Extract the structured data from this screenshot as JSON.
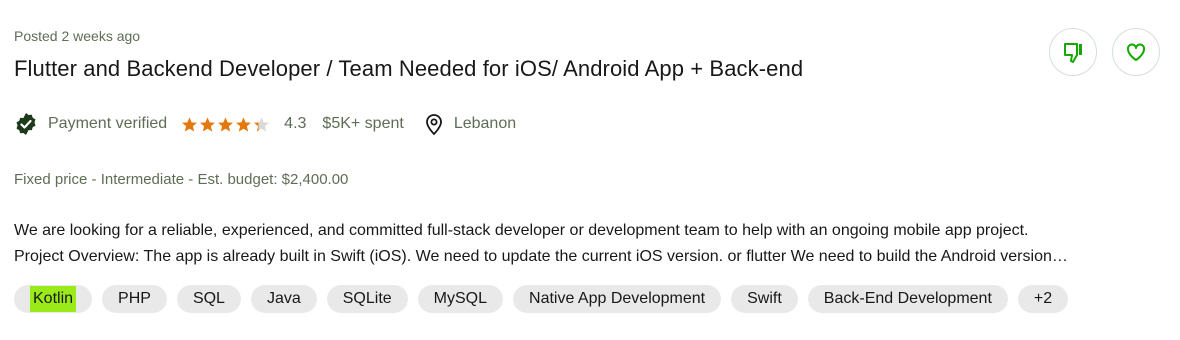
{
  "job": {
    "posted": "Posted 2 weeks ago",
    "title": "Flutter and Backend Developer / Team Needed for iOS/ Android App + Back-end",
    "actions": {
      "dislike_icon": "thumbs-down-icon",
      "save_icon": "heart-icon"
    },
    "client": {
      "payment_status": "Payment verified",
      "rating_value": "4.3",
      "stars_filled_fraction": 0.86,
      "spent": "$5K+ spent",
      "location": "Lebanon"
    },
    "budget": {
      "type": "Fixed price",
      "sep": " - ",
      "level": "Intermediate",
      "budget_label": "Est. budget: $2,400.00"
    },
    "description": {
      "line1": "We are looking for a reliable, experienced, and committed full-stack developer or development team to help with an ongoing mobile app project.",
      "line2": "Project Overview: The app is already built in Swift (iOS). We need to update the current iOS version. or flutter We need to build the Android version…"
    },
    "tags": [
      "Kotlin",
      "PHP",
      "SQL",
      "Java",
      "SQLite",
      "MySQL",
      "Native App Development",
      "Swift",
      "Back-End Development",
      "+2"
    ],
    "colors": {
      "accent_green": "#14a800",
      "star_orange": "#e5780c",
      "highlight": "#9aea1a",
      "muted": "#5e6d55"
    }
  }
}
